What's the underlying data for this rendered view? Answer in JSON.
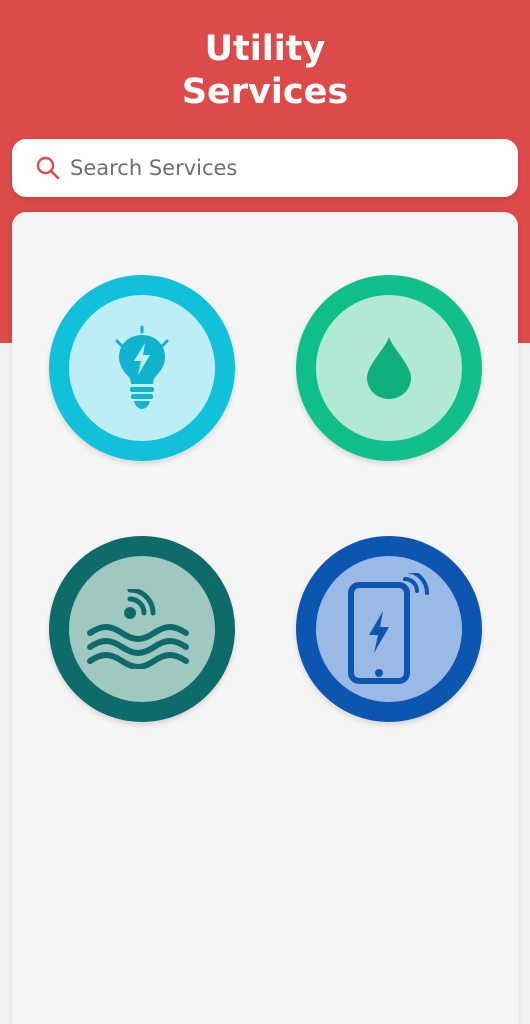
{
  "header": {
    "title_line1": "Utility",
    "title_line2": "Services",
    "color": "#dc4a4a"
  },
  "search": {
    "placeholder": "Search Services",
    "value": "",
    "icon": "search-icon"
  },
  "services": [
    {
      "id": "electricity",
      "icon": "lightbulb-bolt-icon",
      "outer": "#11c1da",
      "inner": "#bdeef6",
      "glyph": "#11b3cf"
    },
    {
      "id": "water",
      "icon": "water-drop-icon",
      "outer": "#11bf8c",
      "inner": "#b1e9d4",
      "glyph": "#10b07e"
    },
    {
      "id": "gas-internet",
      "icon": "waves-signal-icon",
      "outer": "#0f6a6a",
      "inner": "#9ec8c0",
      "glyph": "#0f6a6a"
    },
    {
      "id": "mobile",
      "icon": "phone-bolt-icon",
      "outer": "#0c55b0",
      "inner": "#9bb9e6",
      "glyph": "#0c55b0"
    }
  ]
}
